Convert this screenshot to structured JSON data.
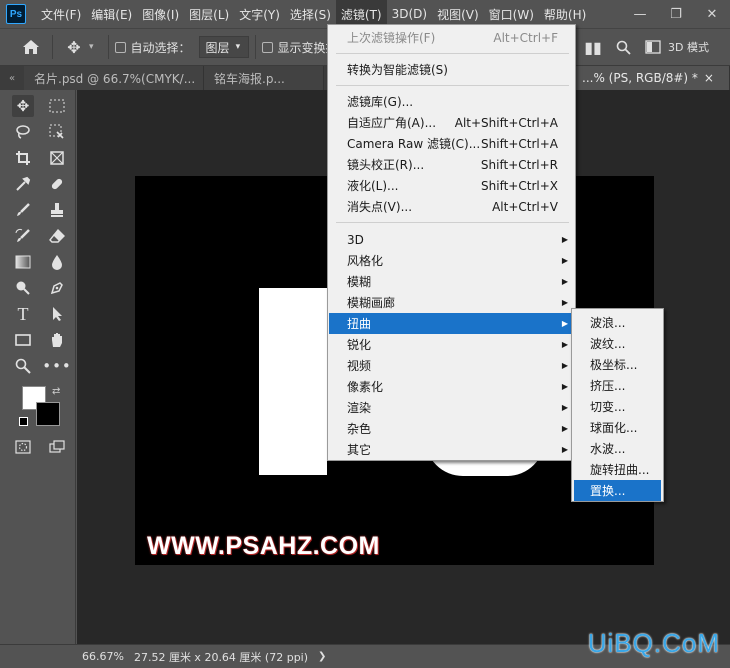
{
  "app": {
    "logo_text": "Ps",
    "menu": [
      "文件(F)",
      "编辑(E)",
      "图像(I)",
      "图层(L)",
      "文字(Y)",
      "选择(S)",
      "滤镜(T)",
      "3D(D)",
      "视图(V)",
      "窗口(W)",
      "帮助(H)"
    ],
    "window_controls": {
      "minimize": "—",
      "restore": "❐",
      "close": "✕"
    }
  },
  "options_bar": {
    "auto_select_label": "自动选择：",
    "auto_select_value": "图层",
    "show_transform_label": "显示变换控件",
    "mode_3d_label": "3D 模式"
  },
  "tabs": [
    {
      "label": "名片.psd @ 66.7%(CMYK/...",
      "close": "×"
    },
    {
      "label": "铭车海报.p...",
      "close": ""
    },
    {
      "label": "...% (PS, RGB/8#) *",
      "close": "×"
    }
  ],
  "canvas": {
    "watermark": "WWW.PSAHZ.COM"
  },
  "status_bar": {
    "zoom": "66.67%",
    "doc_info": "27.52 厘米 x 20.64 厘米 (72 ppi)",
    "arrow": "❯"
  },
  "site_logo": "UiBQ.CoM",
  "filter_menu": {
    "items": [
      {
        "label": "上次滤镜操作(F)",
        "shortcut": "Alt+Ctrl+F",
        "disabled": true
      },
      {
        "label": "转换为智能滤镜(S)",
        "shortcut": ""
      },
      {
        "label": "滤镜库(G)...",
        "shortcut": ""
      },
      {
        "label": "自适应广角(A)...",
        "shortcut": "Alt+Shift+Ctrl+A"
      },
      {
        "label": "Camera Raw 滤镜(C)...",
        "shortcut": "Shift+Ctrl+A"
      },
      {
        "label": "镜头校正(R)...",
        "shortcut": "Shift+Ctrl+R"
      },
      {
        "label": "液化(L)...",
        "shortcut": "Shift+Ctrl+X"
      },
      {
        "label": "消失点(V)...",
        "shortcut": "Alt+Ctrl+V"
      },
      {
        "label": "3D",
        "submenu": true
      },
      {
        "label": "风格化",
        "submenu": true
      },
      {
        "label": "模糊",
        "submenu": true
      },
      {
        "label": "模糊画廊",
        "submenu": true
      },
      {
        "label": "扭曲",
        "submenu": true,
        "highlighted": true
      },
      {
        "label": "锐化",
        "submenu": true
      },
      {
        "label": "视频",
        "submenu": true
      },
      {
        "label": "像素化",
        "submenu": true
      },
      {
        "label": "渲染",
        "submenu": true
      },
      {
        "label": "杂色",
        "submenu": true
      },
      {
        "label": "其它",
        "submenu": true
      }
    ]
  },
  "distort_submenu": {
    "items": [
      "波浪...",
      "波纹...",
      "极坐标...",
      "挤压...",
      "切变...",
      "球面化...",
      "水波...",
      "旋转扭曲...",
      "置换..."
    ],
    "highlighted_index": 8
  }
}
